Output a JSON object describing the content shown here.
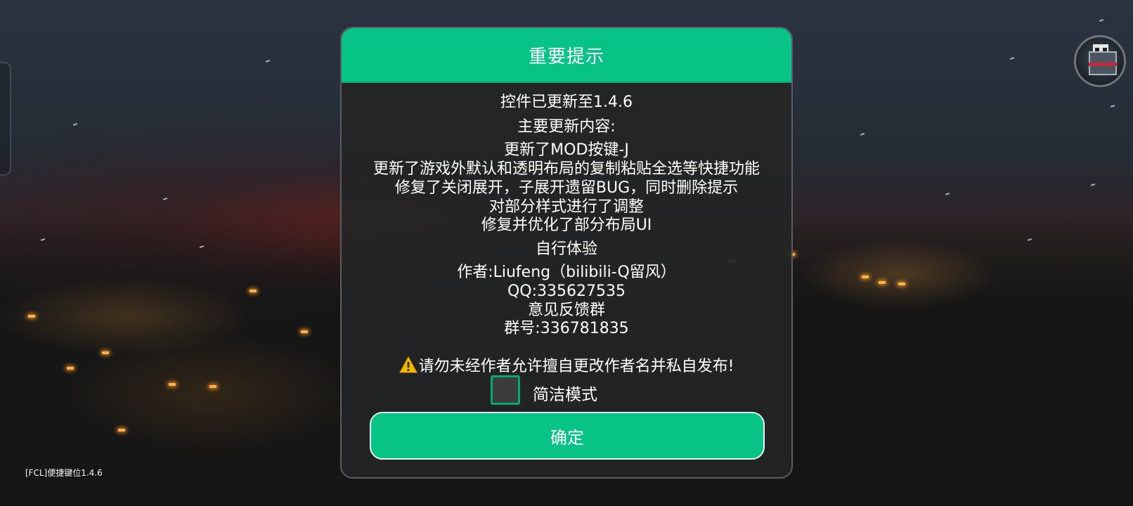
{
  "dialog": {
    "title": "重要提示",
    "lines": [
      "控件已更新至1.4.6",
      "主要更新内容:",
      "更新了MOD按键-J",
      "更新了游戏外默认和透明布局的复制粘贴全选等快捷功能",
      "修复了关闭展开，子展开遗留BUG，同时删除提示",
      "对部分样式进行了调整",
      "修复并优化了部分布局UI",
      "自行体验",
      "作者:Liufeng（bilibili-Q留风）",
      "QQ:335627535",
      "意见反馈群",
      "群号:336781835"
    ],
    "warning": "请勿未经作者允许擅自更改作者名并私自发布!",
    "warning_icon": "warning-icon",
    "checkbox_label": "简洁模式",
    "checkbox_checked": false,
    "confirm_label": "确定"
  },
  "footer": {
    "label": "[FCL]便捷键位1.4.6"
  },
  "colors": {
    "accent": "#07c386",
    "dialog_bg": "#242526",
    "text": "#ffffff"
  }
}
